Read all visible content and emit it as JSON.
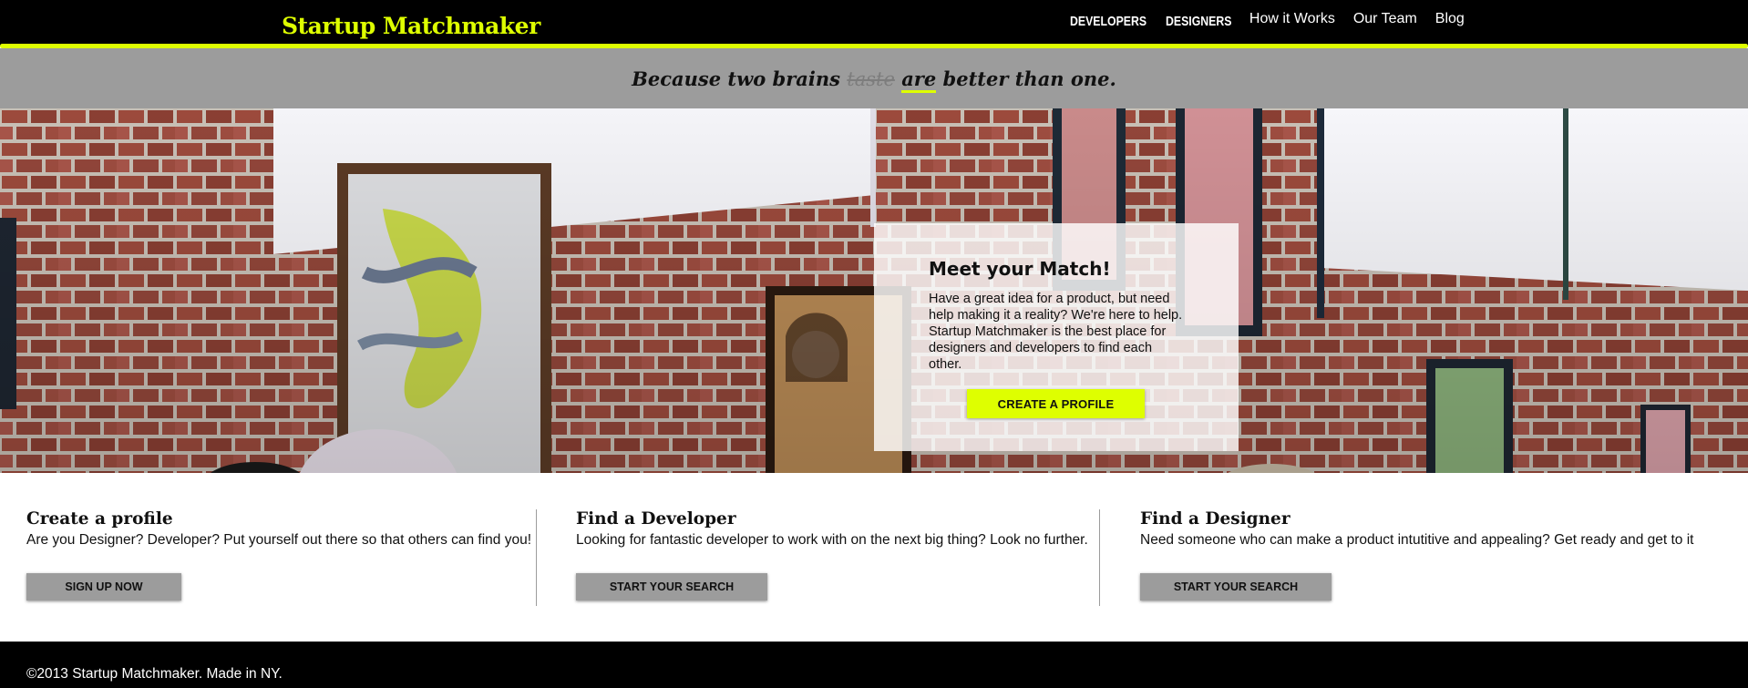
{
  "brand": {
    "name": "Startup Matchmaker",
    "accent_color": "#deff00"
  },
  "nav": {
    "items": [
      {
        "label": "DEVELOPERS"
      },
      {
        "label": "DESIGNERS"
      },
      {
        "label": "How it Works"
      },
      {
        "label": "Our Team"
      },
      {
        "label": "Blog"
      }
    ]
  },
  "tagline": {
    "before": "Because two brains ",
    "struck": "taste",
    "highlight": "are",
    "after": " better than one."
  },
  "hero": {
    "image_description_icon": "brick-wall-photo",
    "card": {
      "title": "Meet your Match!",
      "text": "Have a great idea for a product, but need help making it a reality? We're here to help. Startup Matchmaker is the best place for designers and developers to find each other.",
      "button_label": "CREATE A PROFILE"
    }
  },
  "features": [
    {
      "title": "Create a profile",
      "text": "Are you Designer? Developer? Put yourself out there so that others can find you!",
      "button_label": "SIGN UP NOW"
    },
    {
      "title": "Find a Developer",
      "text": "Looking for fantastic developer to work with on the next big thing? Look no further.",
      "button_label": "START YOUR SEARCH"
    },
    {
      "title": "Find a Designer",
      "text": "Need someone who can make a product intutitive and appealing? Get ready and get to it",
      "button_label": "START YOUR SEARCH"
    }
  ],
  "footer": {
    "text": "©2013 Startup Matchmaker. Made in NY."
  },
  "colors": {
    "background_dark": "#000000",
    "band_gray": "#9c9c9c",
    "accent": "#deff00"
  }
}
